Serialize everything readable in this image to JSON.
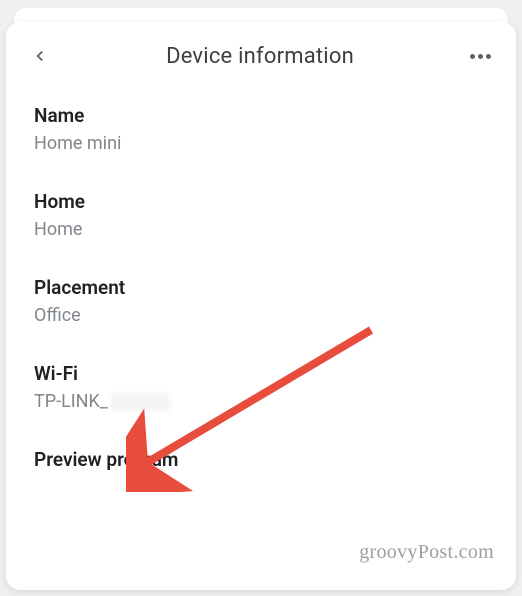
{
  "header": {
    "title": "Device information"
  },
  "sections": {
    "name": {
      "label": "Name",
      "value": "Home mini"
    },
    "home": {
      "label": "Home",
      "value": "Home"
    },
    "placement": {
      "label": "Placement",
      "value": "Office"
    },
    "wifi": {
      "label": "Wi-Fi",
      "value": "TP-LINK_"
    },
    "preview": {
      "label": "Preview program"
    }
  },
  "watermark": "groovyPost.com"
}
